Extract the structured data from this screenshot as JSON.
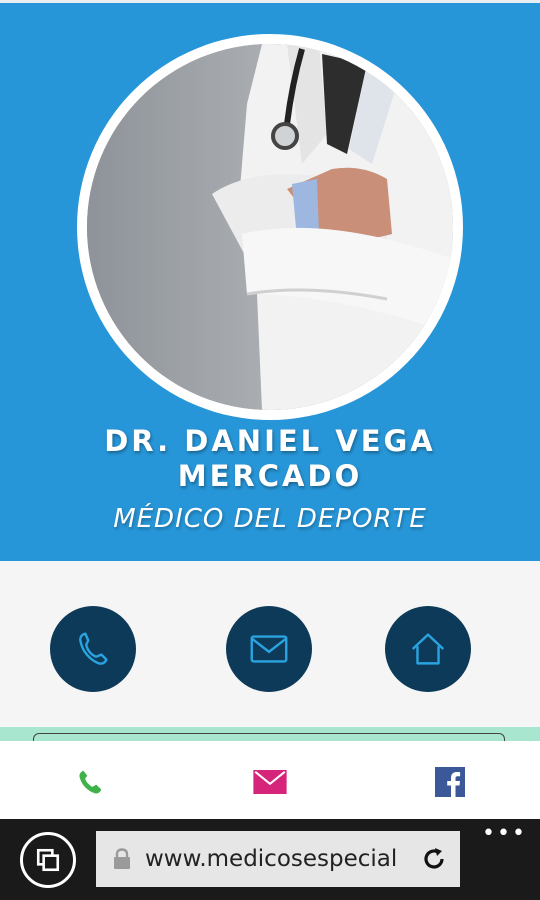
{
  "profile": {
    "name_line1": "DR. DANIEL VEGA",
    "name_line2": "MERCADO",
    "specialty": "MÉDICO DEL DEPORTE"
  },
  "actions": [
    {
      "icon": "phone-icon"
    },
    {
      "icon": "mail-icon"
    },
    {
      "icon": "home-icon"
    }
  ],
  "bottom_bar": [
    {
      "icon": "phone-icon",
      "color": "#3fb24a"
    },
    {
      "icon": "mail-icon",
      "color": "#d6247a"
    },
    {
      "icon": "facebook-icon",
      "color": "#3b5998"
    }
  ],
  "browser": {
    "url": "www.medicosespecial",
    "more_label": "•••"
  },
  "colors": {
    "hero": "#2796d8",
    "action_circle": "#0d3a58",
    "action_icon": "#2aa3e0"
  }
}
